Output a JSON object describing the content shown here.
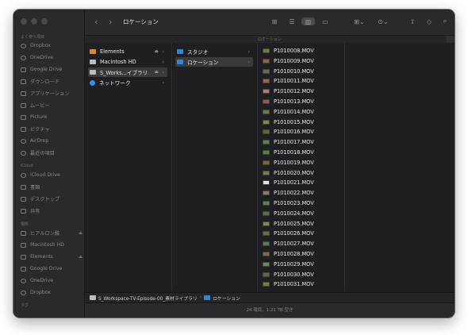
{
  "window": {
    "title": "ロケーション"
  },
  "sidebar": {
    "favorites_heading": "よく使う項目",
    "favorites": [
      {
        "label": "Dropbox",
        "icon": "dropbox-icon"
      },
      {
        "label": "OneDrive",
        "icon": "cloud-icon"
      },
      {
        "label": "Google Drive",
        "icon": "google-drive-icon"
      },
      {
        "label": "ダウンロード",
        "icon": "download-icon"
      },
      {
        "label": "アプリケーション",
        "icon": "applications-icon"
      },
      {
        "label": "ムービー",
        "icon": "movies-icon"
      },
      {
        "label": "Picture",
        "icon": "folder-icon"
      },
      {
        "label": "ピクチャ",
        "icon": "pictures-icon"
      },
      {
        "label": "AirDrop",
        "icon": "airdrop-icon"
      },
      {
        "label": "最近の項目",
        "icon": "clock-icon"
      }
    ],
    "icloud_heading": "iCloud",
    "icloud": [
      {
        "label": "iCloud Drive",
        "icon": "icloud-icon"
      },
      {
        "label": "書類",
        "icon": "documents-icon"
      },
      {
        "label": "デスクトップ",
        "icon": "desktop-icon"
      },
      {
        "label": "共有",
        "icon": "shared-folder-icon"
      }
    ],
    "locations_heading": "場所",
    "locations": [
      {
        "label": "ヒアルロン酸",
        "icon": "laptop-icon",
        "eject": "⏏"
      },
      {
        "label": "Macintosh HD",
        "icon": "disk-icon"
      },
      {
        "label": "Elements",
        "icon": "external-disk-icon",
        "eject": "⏏"
      },
      {
        "label": "Google Drive",
        "icon": "google-drive-icon"
      },
      {
        "label": "OneDrive",
        "icon": "cloud-icon"
      },
      {
        "label": "Dropbox",
        "icon": "dropbox-icon"
      }
    ],
    "tags_heading": "タグ"
  },
  "toolbar": {
    "back": "‹",
    "forward": "›",
    "view_icons": "⊞",
    "view_list": "☰",
    "view_columns": "▥",
    "view_gallery": "▭",
    "group": "⊞⌄",
    "action": "⊙⌄",
    "share": "⇪",
    "tag": "◇",
    "search": "⌕"
  },
  "pathbar_label": "ロケーション",
  "columns": {
    "col1": [
      {
        "label": "Elements",
        "type": "orange",
        "eject": "⏏",
        "chevron": "›"
      },
      {
        "label": "Macintosh HD",
        "type": "disk",
        "chevron": "›"
      },
      {
        "label": "S_Works...イブラリ",
        "type": "disk",
        "eject": "⏏",
        "chevron": "›",
        "selected": true
      },
      {
        "label": "ネットワーク",
        "type": "net",
        "chevron": "›"
      }
    ],
    "col2": [
      {
        "label": "スタジオ",
        "type": "folder",
        "chevron": "›"
      },
      {
        "label": "ロケーション",
        "type": "folder",
        "chevron": "›",
        "selected": true
      }
    ],
    "col3": [
      "P1010008.MOV",
      "P1010009.MOV",
      "P1010010.MOV",
      "P1010011.MOV",
      "P1010012.MOV",
      "P1010013.MOV",
      "P1010014.MOV",
      "P1010015.MOV",
      "P1010016.MOV",
      "P1010017.MOV",
      "P1010018.MOV",
      "P1010019.MOV",
      "P1010020.MOV",
      "P1010021.MOV",
      "P1010022.MOV",
      "P1010023.MOV",
      "P1010024.MOV",
      "P1010025.MOV",
      "P1010026.MOV",
      "P1010027.MOV",
      "P1010028.MOV",
      "P1010029.MOV",
      "P1010030.MOV",
      "P1010031.MOV"
    ]
  },
  "bottom_path": {
    "root": "S_Workspace-TV-Episode-00_素材ライブラリ",
    "separator": "›",
    "current": "ロケーション"
  },
  "status": "24 項目、1.21 TB 空き"
}
